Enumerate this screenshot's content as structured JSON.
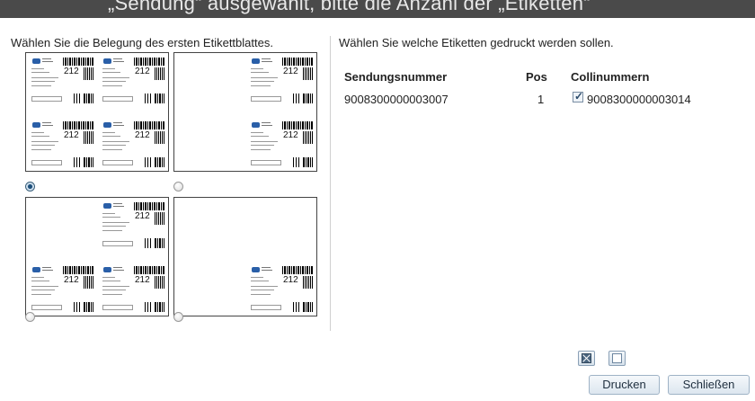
{
  "window": {
    "title": "„Sendung“ ausgewählt, bitte die Anzahl der „Etiketten“"
  },
  "left_panel": {
    "heading": "Wählen Sie die Belegung des ersten Etikettblattes.",
    "sheets": [
      {
        "id": "layout-1",
        "selected": true
      },
      {
        "id": "layout-2",
        "selected": false
      },
      {
        "id": "layout-3",
        "selected": false
      },
      {
        "id": "layout-4",
        "selected": false
      }
    ],
    "label_number": "212"
  },
  "right_panel": {
    "heading": "Wählen Sie welche Etiketten gedruckt werden sollen.",
    "columns": [
      "Sendungsnummer",
      "Pos",
      "Collinummern"
    ],
    "rows": [
      {
        "sendungsnummer": "9008300000003007",
        "pos": "1",
        "collinummer": "9008300000003014",
        "checked": true
      }
    ]
  },
  "toolbar": {
    "deselect_all_icon": "deselect-all-icon",
    "select_all_icon": "select-all-icon"
  },
  "buttons": {
    "print_label": "Drucken",
    "close_label": "Schließen"
  },
  "colors": {
    "title_bar": "#4a4a4a",
    "accent": "#1d4f7a",
    "button_border": "#9fb3c6"
  }
}
